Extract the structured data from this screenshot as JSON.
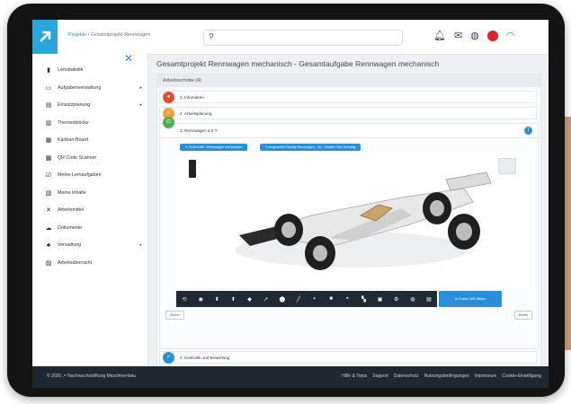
{
  "header": {
    "breadcrumb_link": "Projekte",
    "breadcrumb_sep": " / ",
    "breadcrumb_current": "Gesamtprojekt Rennwagen",
    "search_placeholder": ""
  },
  "sidebar": {
    "items": [
      {
        "label": "Lernstatistik",
        "icon": "chart-icon",
        "arrow": ""
      },
      {
        "label": "Aufgabenverwaltung",
        "icon": "folder-icon",
        "arrow": "▸"
      },
      {
        "label": "Einsatzplanung",
        "icon": "clipboard-icon",
        "arrow": "▸"
      },
      {
        "label": "Themenblöcke",
        "icon": "book-icon",
        "arrow": ""
      },
      {
        "label": "Kanban-Board",
        "icon": "board-icon",
        "arrow": ""
      },
      {
        "label": "QR Code Scanner",
        "icon": "qr-icon",
        "arrow": ""
      },
      {
        "label": "Meine Lernaufgaben",
        "icon": "task-icon",
        "arrow": ""
      },
      {
        "label": "Meine Inhalte",
        "icon": "content-icon",
        "arrow": ""
      },
      {
        "label": "Arbeitsmittel",
        "icon": "tools-icon",
        "arrow": ""
      },
      {
        "label": "Dokumente",
        "icon": "cloud-icon",
        "arrow": ""
      },
      {
        "label": "Verwaltung",
        "icon": "people-icon",
        "arrow": "▸"
      },
      {
        "label": "Arbeitsübersicht",
        "icon": "overview-icon",
        "arrow": ""
      }
    ]
  },
  "main": {
    "title": "Gesamtprojekt Rennwagen mechanisch - Gesamtaufgabe Rennwagen mechanisch",
    "panel_header": "Arbeitsschritte (4)",
    "steps": [
      {
        "label": "1. Infomieren",
        "color": "#e84a2e"
      },
      {
        "label": "2. Arbeitsplanung",
        "color": "#f0a030"
      },
      {
        "label": "3. Rennwagen 4.0 ✎",
        "color": "#4caf50"
      },
      {
        "label": "4. Kontrolle und Bewertung",
        "color": "#2a8fd6"
      }
    ],
    "tags": [
      "✎ Fusion360 - Rennwagen mechanisch",
      "✎ Augmented Reality Rennwagen - 3D- / Mobile Fahr Schnittig"
    ],
    "toolbar_icons": [
      "⟲",
      "◉",
      "⬍",
      "⬆",
      "◆",
      "↗",
      "⬤",
      "╱",
      "◐",
      "■",
      "◓",
      "▚",
      "▣",
      "⚙",
      "◍",
      "▤"
    ],
    "fusion_button": "In Fusion 360 öffnen",
    "left_button": "Zurück",
    "right_button": "Weiter"
  },
  "footer": {
    "copyright": "© 2025 ↗ Nachwuchsstiftung Maschinenbau",
    "links": [
      "Hilfe & Tipps",
      "Support",
      "Datenschutz",
      "Nutzungsbedingungen",
      "Impressum",
      "Cookie-Einwilligung"
    ]
  },
  "colors": {
    "accent": "#2a8fd6",
    "logo": "#29a6db",
    "footer": "#1e2833"
  }
}
